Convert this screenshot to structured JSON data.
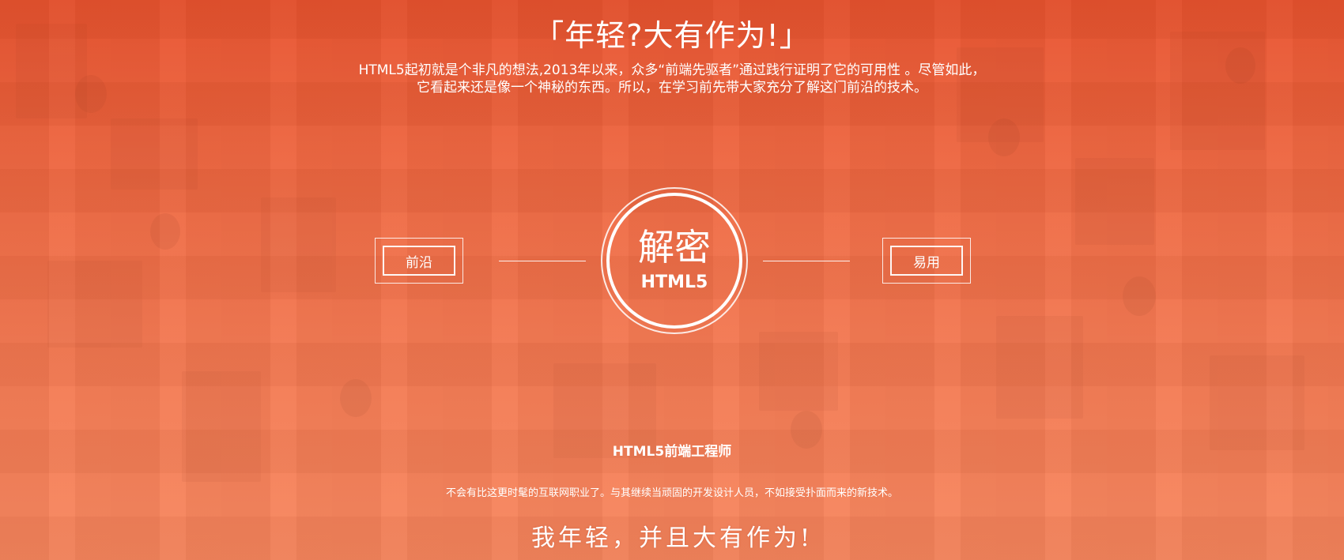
{
  "headline": "「年轻?大有作为!」",
  "intro": "HTML5起初就是个非凡的想法,2013年以来，众多“前端先驱者”通过践行证明了它的可用性 。尽管如此，它看起来还是像一个神秘的东西。所以，在学习前先带大家充分了解这门前沿的技术。",
  "left_box": {
    "label": "前沿"
  },
  "right_box": {
    "label": "易用"
  },
  "core": {
    "title": "解密",
    "subtitle": "HTML5"
  },
  "role": {
    "title": "HTML5前端工程师",
    "description": "不会有比这更时髦的互联网职业了。与其继续当顽固的开发设计人员，不如接受扑面而来的新技术。"
  },
  "slogan": "我年轻，并且大有作为!",
  "colors": {
    "bg_top": "#e7532f",
    "bg_bottom": "#f6875f",
    "text": "#ffffff"
  }
}
